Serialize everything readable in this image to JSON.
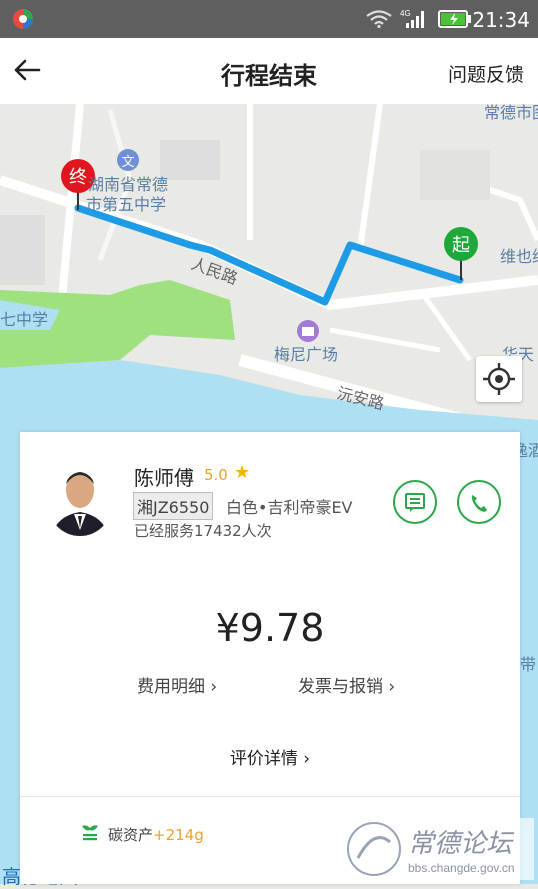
{
  "status_bar": {
    "time": "21:34",
    "network": "4G"
  },
  "nav": {
    "title": "行程结束",
    "feedback": "问题反馈",
    "back_icon": "back-arrow-icon"
  },
  "map": {
    "labels": {
      "top_right": "常德市图",
      "school_line1": "湖南省常德",
      "school_line2": "市第五中学",
      "road1": "人民路",
      "road2": "沅安路",
      "plaza": "梅尼广场",
      "left_school": "七中学",
      "right_top": "维也纳",
      "right_mid": "华天",
      "right_low": "逸酒",
      "right_edge": "带"
    },
    "start_marker": "起",
    "end_marker": "终",
    "route_color": "#1d9be7",
    "logo": "高德地图"
  },
  "driver": {
    "name": "陈师傅",
    "rating": "5.0",
    "plate": "湘JZ6550",
    "car": "白色•吉利帝豪EV",
    "served": "已经服务17432人次"
  },
  "trip": {
    "price": "¥9.78",
    "fee_detail": "费用明细 ›",
    "invoice": "发票与报销 ›",
    "review": "评价详情 ›"
  },
  "carbon": {
    "label": "碳资产",
    "value": "+214g"
  },
  "watermark": {
    "name": "常德论坛",
    "site": "bbs.changde.gov.cn"
  },
  "colors": {
    "accent_green": "#2aa64b",
    "route_blue": "#1d9be7",
    "rating_orange": "#f2a12b",
    "water": "#aee0f3",
    "park": "#9fe07f"
  }
}
